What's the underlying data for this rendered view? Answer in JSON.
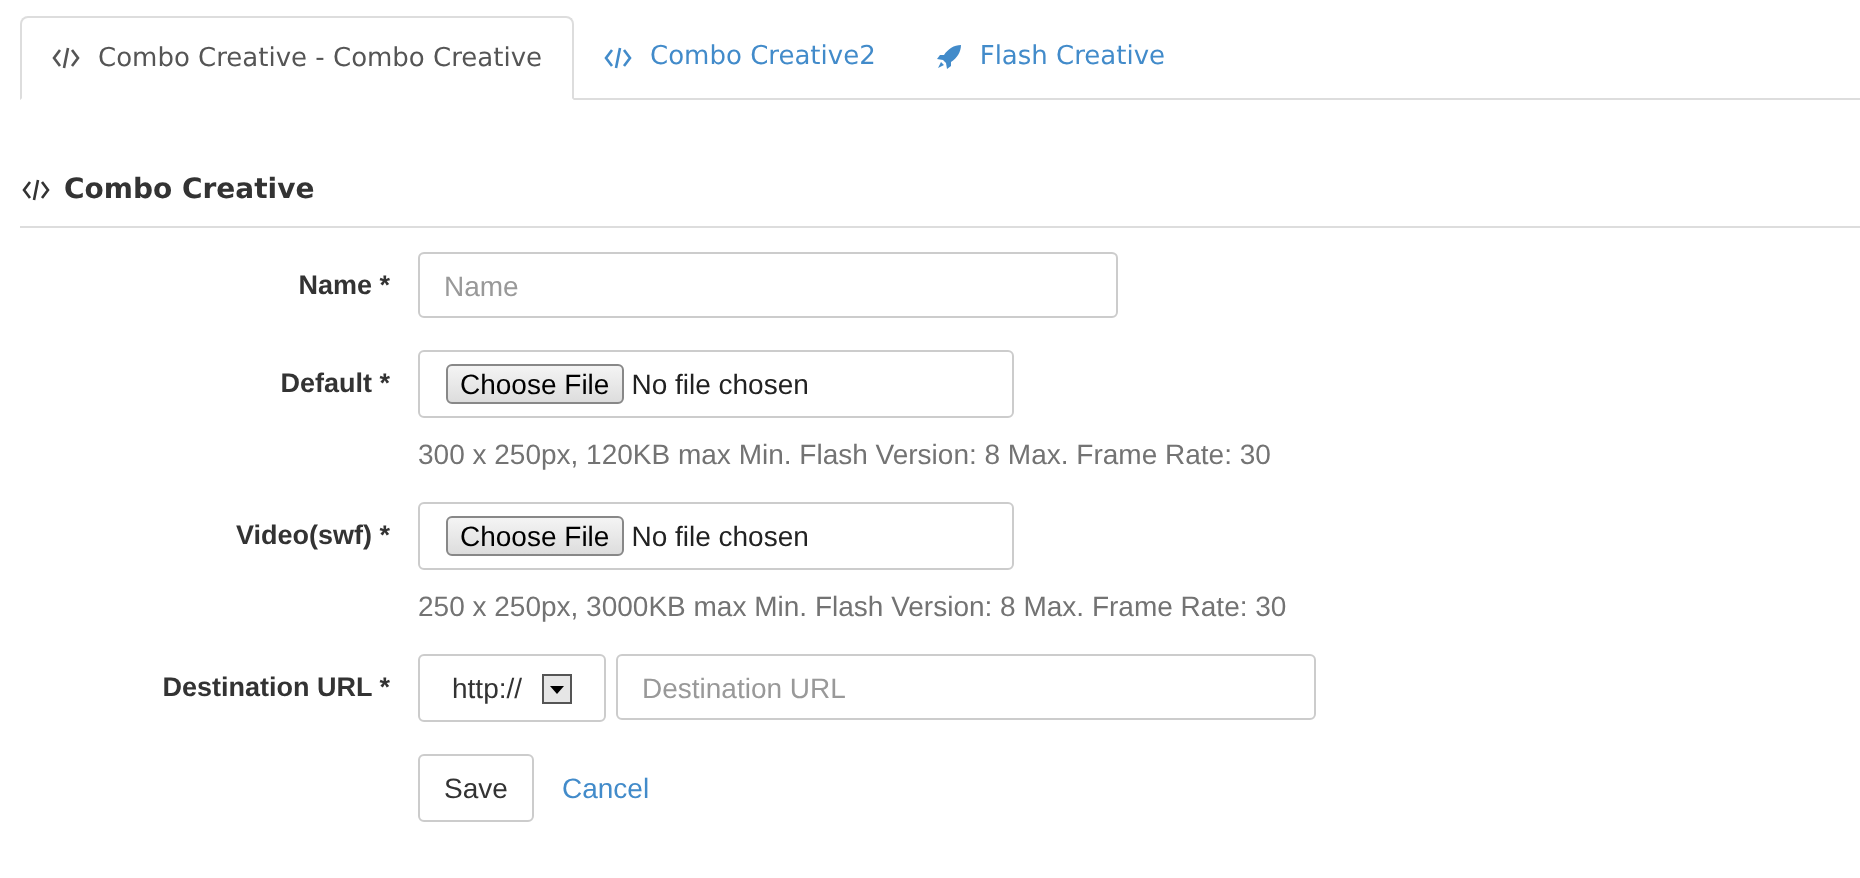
{
  "tabs": [
    {
      "label": "Combo Creative - Combo Creative",
      "kind": "code",
      "selected": true
    },
    {
      "label": "Combo Creative2",
      "kind": "code",
      "selected": false
    },
    {
      "label": "Flash Creative",
      "kind": "rocket",
      "selected": false
    }
  ],
  "section": {
    "title": "Combo Creative"
  },
  "fields": [
    {
      "kind": "text",
      "label": "Name *",
      "placeholder": "Name"
    },
    {
      "kind": "file",
      "label": "Default *",
      "button": "Choose File",
      "status": "No file chosen",
      "help": "300 x 250px, 120KB max Min. Flash Version: 8 Max. Frame Rate: 30"
    },
    {
      "kind": "file",
      "label": "Video(swf) *",
      "button": "Choose File",
      "status": "No file chosen",
      "help": "250 x 250px, 3000KB max Min. Flash Version: 8 Max. Frame Rate: 30"
    },
    {
      "kind": "url",
      "label": "Destination URL *",
      "protocol": "http://",
      "placeholder": "Destination URL"
    }
  ],
  "actions": {
    "save": "Save",
    "cancel": "Cancel"
  }
}
